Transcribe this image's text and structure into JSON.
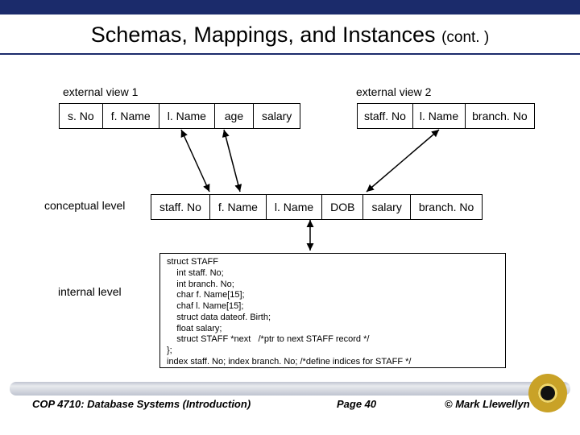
{
  "title": "Schemas, Mappings, and Instances",
  "title_cont": "(cont. )",
  "labels": {
    "ext1": "external view 1",
    "ext2": "external view 2",
    "conceptual": "conceptual level",
    "internal": "internal level"
  },
  "ext1_cols": {
    "c0": "s. No",
    "c1": "f. Name",
    "c2": "l. Name",
    "c3": "age",
    "c4": "salary"
  },
  "ext2_cols": {
    "c0": "staff. No",
    "c1": "l. Name",
    "c2": "branch. No"
  },
  "conc_cols": {
    "c0": "staff. No",
    "c1": "f. Name",
    "c2": "l. Name",
    "c3": "DOB",
    "c4": "salary",
    "c5": "branch. No"
  },
  "code_lines": {
    "l0": "struct STAFF",
    "l1": "    int staff. No;",
    "l2": "    int branch. No;",
    "l3": "    char f. Name[15];",
    "l4": "    chaf l. Name[15];",
    "l5": "    struct data dateof. Birth;",
    "l6": "    float salary;",
    "l7": "    struct STAFF *next   /*ptr to next STAFF record */",
    "l8": "};",
    "l9": "index staff. No; index branch. No; /*define indices for STAFF */"
  },
  "footer": {
    "left": "COP 4710: Database Systems  (Introduction)",
    "center": "Page 40",
    "right": "© Mark Llewellyn"
  }
}
